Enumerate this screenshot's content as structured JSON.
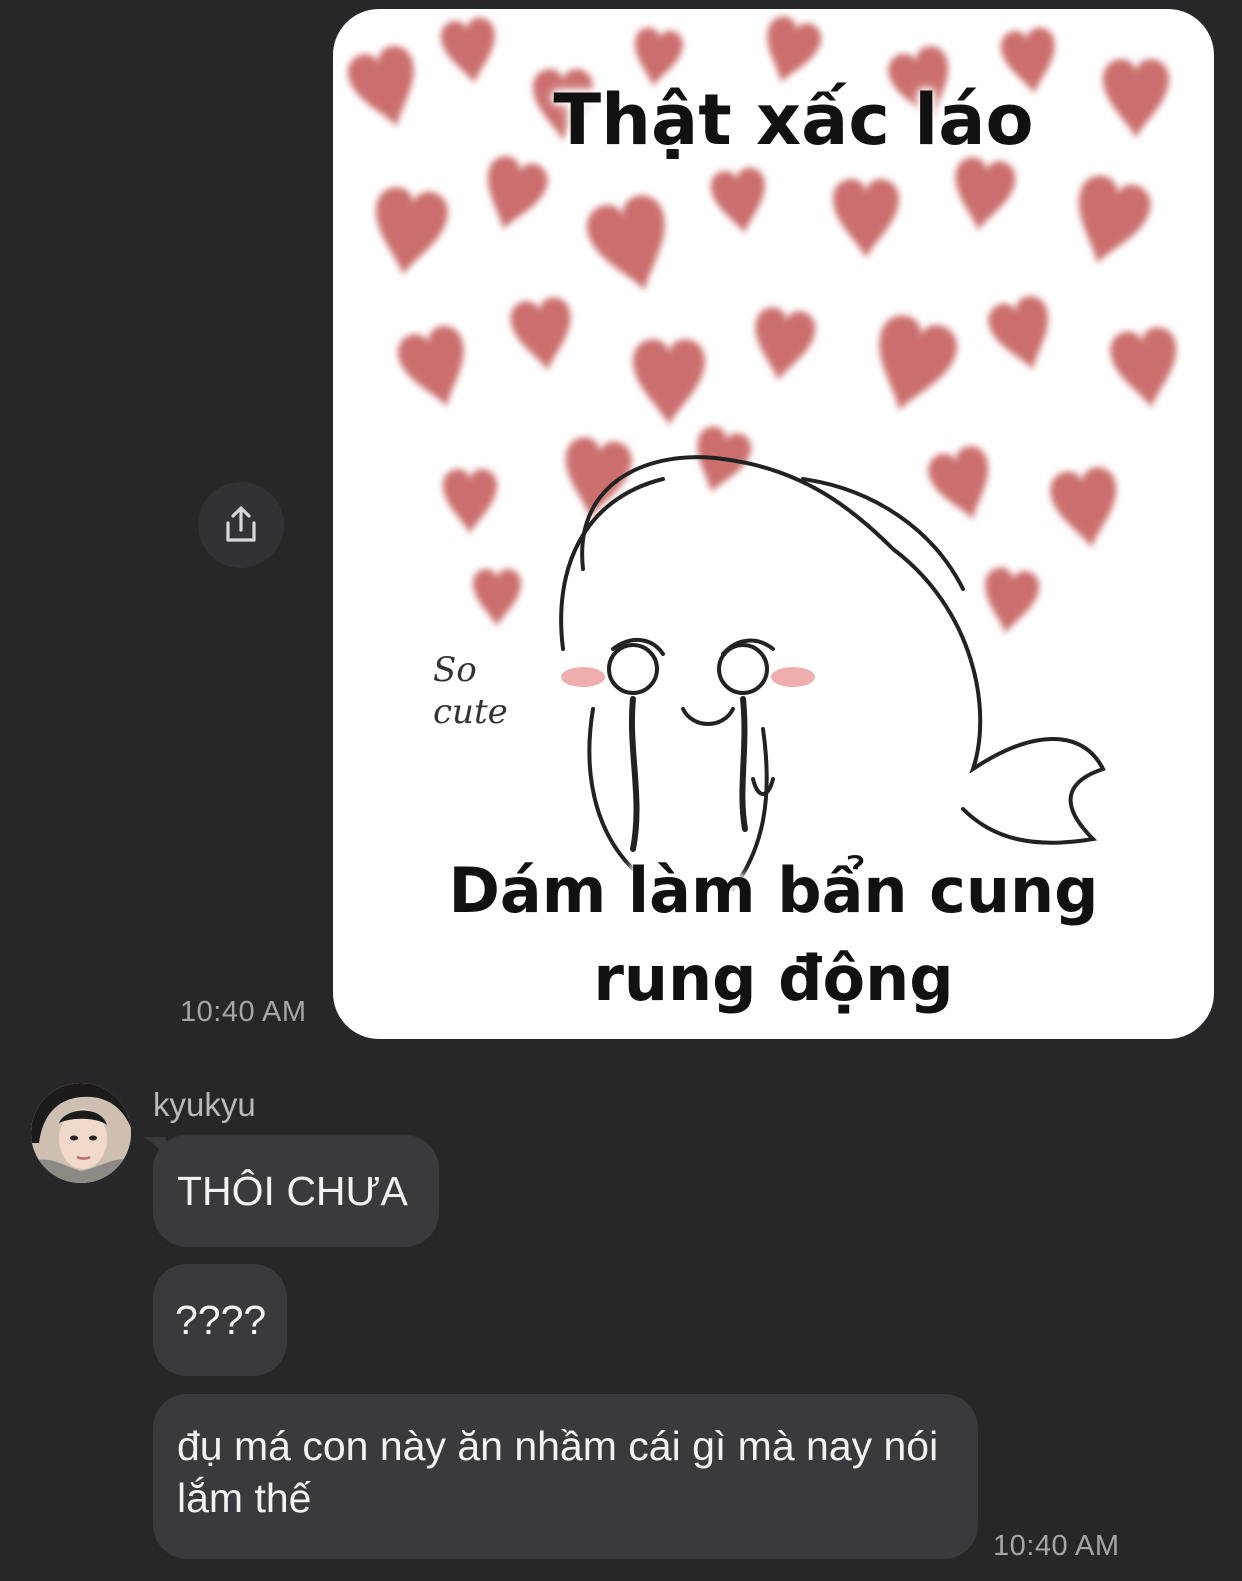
{
  "sticker": {
    "caption_top": "Thật xấc láo",
    "caption_bottom_line1": "Dám làm bẩn cung",
    "caption_bottom_line2": "rung động",
    "doodle_text_line1": "So",
    "doodle_text_line2": "cute"
  },
  "share_button": {
    "icon": "share-icon"
  },
  "messages": [
    {
      "time": "10:40 AM"
    },
    {
      "sender": "kyukyu",
      "text": "THÔI CHƯA"
    },
    {
      "text": "????"
    },
    {
      "text": "đụ má con này ăn nhầm cái gì mà nay nói lắm thế",
      "time": "10:40 AM"
    }
  ],
  "colors": {
    "background": "#27272a",
    "bubble": "#3a3a3e",
    "timestamp": "#a6a6aa",
    "heart": "#c0504d"
  }
}
